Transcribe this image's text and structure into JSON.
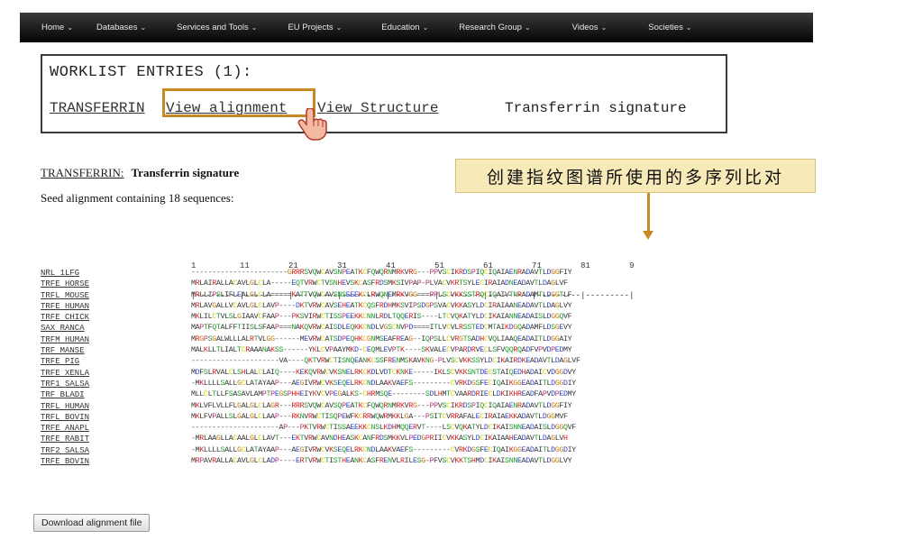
{
  "nav": {
    "items": [
      {
        "label": "Home",
        "caret": "⌄"
      },
      {
        "label": "Databases",
        "caret": "⌄"
      },
      {
        "label": "Services and Tools",
        "caret": "⌄"
      },
      {
        "label": "EU Projects",
        "caret": "⌄"
      },
      {
        "label": "Education",
        "caret": "⌄"
      },
      {
        "label": "Research Group",
        "caret": "⌄"
      },
      {
        "label": "Videos",
        "caret": "⌄"
      },
      {
        "label": "Societies",
        "caret": "⌄"
      }
    ]
  },
  "worklist": {
    "title": "WORKLIST ENTRIES (1):",
    "entry_name": "TRANSFERRIN",
    "view_alignment": "View alignment",
    "view_structure": "View Structure",
    "signature": "Transferrin signature"
  },
  "family": {
    "name": "TRANSFERRIN:",
    "signature": "Transferrin signature",
    "seed_text": "Seed alignment containing 18 sequences:"
  },
  "callout": {
    "text": "创建指纹图谱所使用的多序列比对",
    "color": "#f7e9b8"
  },
  "alignment": {
    "ruler_numbers": "1         11        21        31        41        51        61        71        81        9",
    "ruler_ticks": "|---------|---------|---------|---------|---------|---------|---------|---------|---------|",
    "rows": [
      {
        "name": "NRL 1LFG",
        "seq": "-----------------------GRRRSVQWCAVSNPEATKCFQWQRNMRKVRG---PPVSCIKRDSPIQCIQAIAENRADAVTLDGGFIY"
      },
      {
        "name": "TRFE HORSE",
        "seq": "MRLAIRALLACAVLGLCLA-----EQTVRWCTVSNHEVSKCASFRDSMKSIVPAP-PLVACVKRTSYLECIRAIADNEADAVTLDAGLVF"
      },
      {
        "name": "TRFL MOUSE",
        "seq": "MRLLIPSLIFLEALGLCLA=====KATTVQWCAVSNSEEEKCLRWQNEMRKVGG===PPLSCVKKSSTRQCIQAIVTNRADAMTLDGGTLF"
      },
      {
        "name": "TRFE HUMAN",
        "seq": "MRLAVGALLVCAVLGLCLAVP----DKTVRWCAVSEHEATKCQSFRDHMKSVIPSDGPSVACVKKASYLDCIRAIAANEADAVTLDAGLVY"
      },
      {
        "name": "TRFE CHICK",
        "seq": "MKLILCTVLSLGIAAVCFAAP---PKSVIRWCTISSPEEKKCNNLRDLTQQERIS----LTCVQKATYLDCIKAIANNEADAISLDGGQVF"
      },
      {
        "name": "SAX RANCA",
        "seq": "MAPTFQTALFFTIISLSFAAP===NAKQVRWCAISDLEQKKCNDLVGSCNVPD====ITLVCVLRSSTEDCMTAIKDGQADAMFLDSGEVY"
      },
      {
        "name": "TRFM HUMAN",
        "seq": "MRGPSGALWLLLALRTVLGG------MEVRWCATSDPEQHKCGNMSEAFREAG--IQPSLLCVRGTSADHCVQLIAAQEADAITLDGGAIY"
      },
      {
        "name": "TRF MANSE",
        "seq": "MALKLLTLIALTCRAAANAKSS------YKLCVPAAYMKD-CEQMLEVPTK----SKVALECVPARDRVECLSFVQQRQADFVPVDPEDMY"
      },
      {
        "name": "TRFE PIG",
        "seq": "---------------------VA----QKTVRWCTISNQEANKCSSFRENMSKAVKNG-PLVSCVKKSSYLDCIKAIRDKEADAVTLDAGLVF"
      },
      {
        "name": "TRFE XENLA",
        "seq": "MDFSLRVALCLSHLALCLAIQ----KEKQVRWCVKSNELRKCKDLVDTCKNKE-----IKLSCVKKSNTDECSTAIQEDHADAICVDGGDVY"
      },
      {
        "name": "TRF1 SALSA",
        "seq": "-MKLLLLSALLGCLATAYAAP---AEGIVRWCVKSEQELRKCNDLAAKVAEFS---------CVRKDGSFECIQAIKGGEADAITLDGGDIY"
      },
      {
        "name": "TRF BLADI",
        "seq": "MLLCLTLLFSASAVLAMPTPEGSPHHEIYKVCVPEGALKS-CHRMSQE--------SDLHMTCVAARDRIECLDKIKHREADFAPVDPEDMY"
      },
      {
        "name": "TRFL HUMAN",
        "seq": "MKLVFLVLLFLGALGLCLAGR---RRRSVQWCAVSQPEATKCFQWQRNMRKVRG---PPVSCIKRDSPIQCIQAIAENRADAVTLDGGFIY"
      },
      {
        "name": "TRFL BOVIN",
        "seq": "MKLFVPALLSLGALGLCLAAP---RKNVRWCTISQPEWFKCRRWQWRMKKLGA---PSITCVRRAFALECIRAIAEKKADAVTLDGGMVF"
      },
      {
        "name": "TRFE ANAPL",
        "seq": "---------------------AP---PKTVRWCTISSAEEKKCNSLKDHMQQERVT----LSCVQKATYLDCIKAISNNEADAISLDGGQVF"
      },
      {
        "name": "TRFE RABIT",
        "seq": "-MRLAAGLLACAALGLCLAVT---EKTVRWCAVNDHEASKCANFRDSMKKVLPEDGPRIICVKKASYLDCIKAIAAHEADAVTLDAGLVH"
      },
      {
        "name": "TRF2 SALSA",
        "seq": "-MKLLLLSALLGCLATAYAAP---AEGIVRWCVKSEQELRKCNDLAAKVAEFS---------CVRKDGSFECIQAIKGGEADAITLDGGDIY"
      },
      {
        "name": "TRFE BOVIN",
        "seq": "MRPAVRALLACAVLGLCLADP----ERTVRWCTISTHEANKCASFRENVLRILESG-PFVSCVKKTSHMDCIKAISNNEADAVTLDGGLVY"
      }
    ]
  },
  "download": {
    "label": "Download alignment file"
  },
  "colors": {
    "highlight": "#c98a26",
    "nav_bg": "#1a1a1a"
  }
}
